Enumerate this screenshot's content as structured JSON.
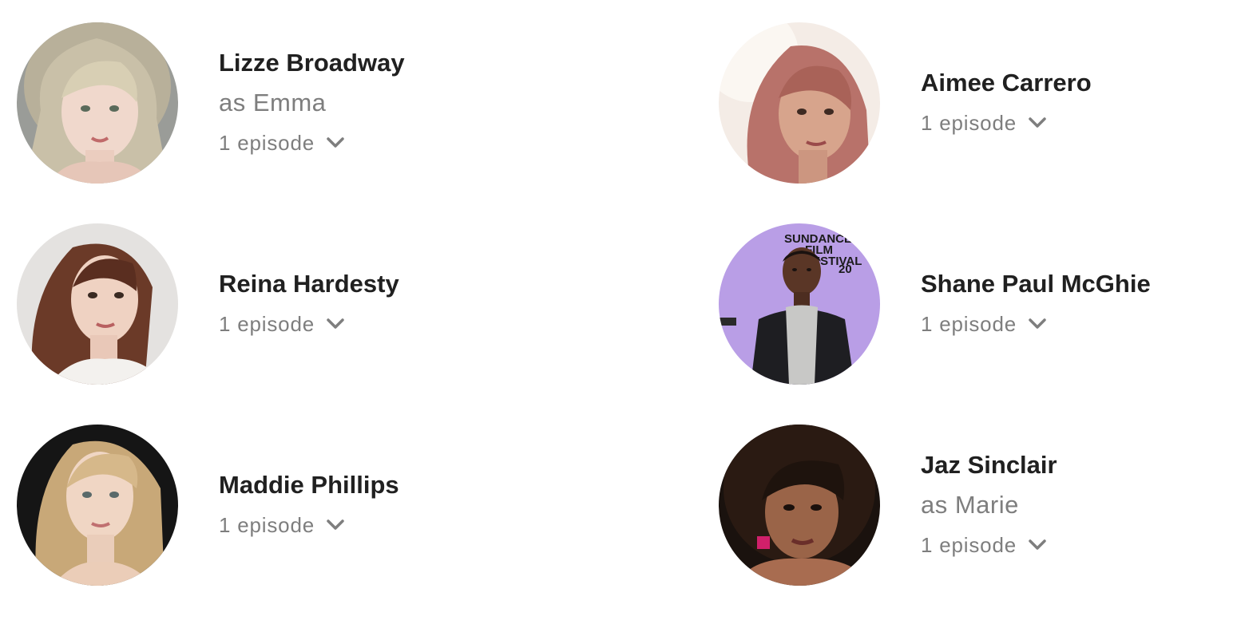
{
  "cast": [
    {
      "name": "Lizze Broadway",
      "role": "as Emma",
      "episodes": "1 episode",
      "expand_icon": "chevron-down-icon"
    },
    {
      "name": "Aimee Carrero",
      "role": "",
      "episodes": "1 episode",
      "expand_icon": "chevron-down-icon"
    },
    {
      "name": "Reina Hardesty",
      "role": "",
      "episodes": "1 episode",
      "expand_icon": "chevron-down-icon"
    },
    {
      "name": "Shane Paul McGhie",
      "role": "",
      "episodes": "1 episode",
      "expand_icon": "chevron-down-icon",
      "photo_backdrop_text": [
        "SUNDANCE",
        "FILM",
        "FESTIVAL",
        "20"
      ]
    },
    {
      "name": "Maddie Phillips",
      "role": "",
      "episodes": "1 episode",
      "expand_icon": "chevron-down-icon"
    },
    {
      "name": "Jaz Sinclair",
      "role": "as Marie",
      "episodes": "1 episode",
      "expand_icon": "chevron-down-icon"
    }
  ],
  "colors": {
    "name_text": "#202020",
    "secondary_text": "#7e7e7e",
    "background": "#ffffff"
  }
}
